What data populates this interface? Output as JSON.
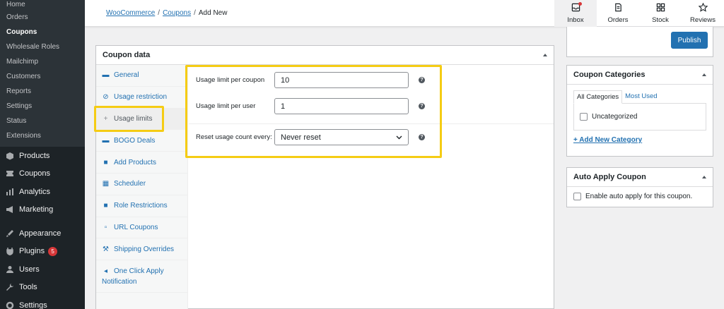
{
  "sidebar": {
    "submenu": [
      "Home",
      "Orders",
      "Coupons",
      "Wholesale Roles",
      "Mailchimp",
      "Customers",
      "Reports",
      "Settings",
      "Status",
      "Extensions"
    ],
    "menu": [
      {
        "label": "Products",
        "icon": "products-icon"
      },
      {
        "label": "Coupons",
        "icon": "coupons-icon"
      },
      {
        "label": "Analytics",
        "icon": "analytics-icon"
      },
      {
        "label": "Marketing",
        "icon": "marketing-icon"
      },
      {
        "label": "Appearance",
        "icon": "appearance-icon"
      },
      {
        "label": "Plugins",
        "icon": "plugins-icon",
        "badge": "5"
      },
      {
        "label": "Users",
        "icon": "users-icon"
      },
      {
        "label": "Tools",
        "icon": "tools-icon"
      },
      {
        "label": "Settings",
        "icon": "settings-icon"
      }
    ]
  },
  "breadcrumb": {
    "woocommerce": "WooCommerce",
    "coupons": "Coupons",
    "current": "Add New",
    "sep": "/"
  },
  "topnav": [
    "Inbox",
    "Orders",
    "Stock",
    "Reviews"
  ],
  "coupon_panel": {
    "title": "Coupon data",
    "tabs": [
      "General",
      "Usage restriction",
      "Usage limits",
      "BOGO Deals",
      "Add Products",
      "Scheduler",
      "Role Restrictions",
      "URL Coupons",
      "Shipping Overrides",
      "One Click Apply Notification"
    ],
    "fields": {
      "limit_per_coupon_label": "Usage limit per coupon",
      "limit_per_coupon_value": "10",
      "limit_per_user_label": "Usage limit per user",
      "limit_per_user_value": "1",
      "reset_label": "Reset usage count every:",
      "reset_value": "Never reset"
    }
  },
  "publish": {
    "button": "Publish"
  },
  "categories": {
    "title": "Coupon Categories",
    "tab_all": "All Categories",
    "tab_used": "Most Used",
    "item": "Uncategorized",
    "add": "+ Add New Category"
  },
  "auto_apply": {
    "title": "Auto Apply Coupon",
    "label": "Enable auto apply for this coupon."
  },
  "colors": {
    "accent": "#2271b1",
    "highlight": "#f5cc14",
    "sidebar": "#1d2327"
  }
}
